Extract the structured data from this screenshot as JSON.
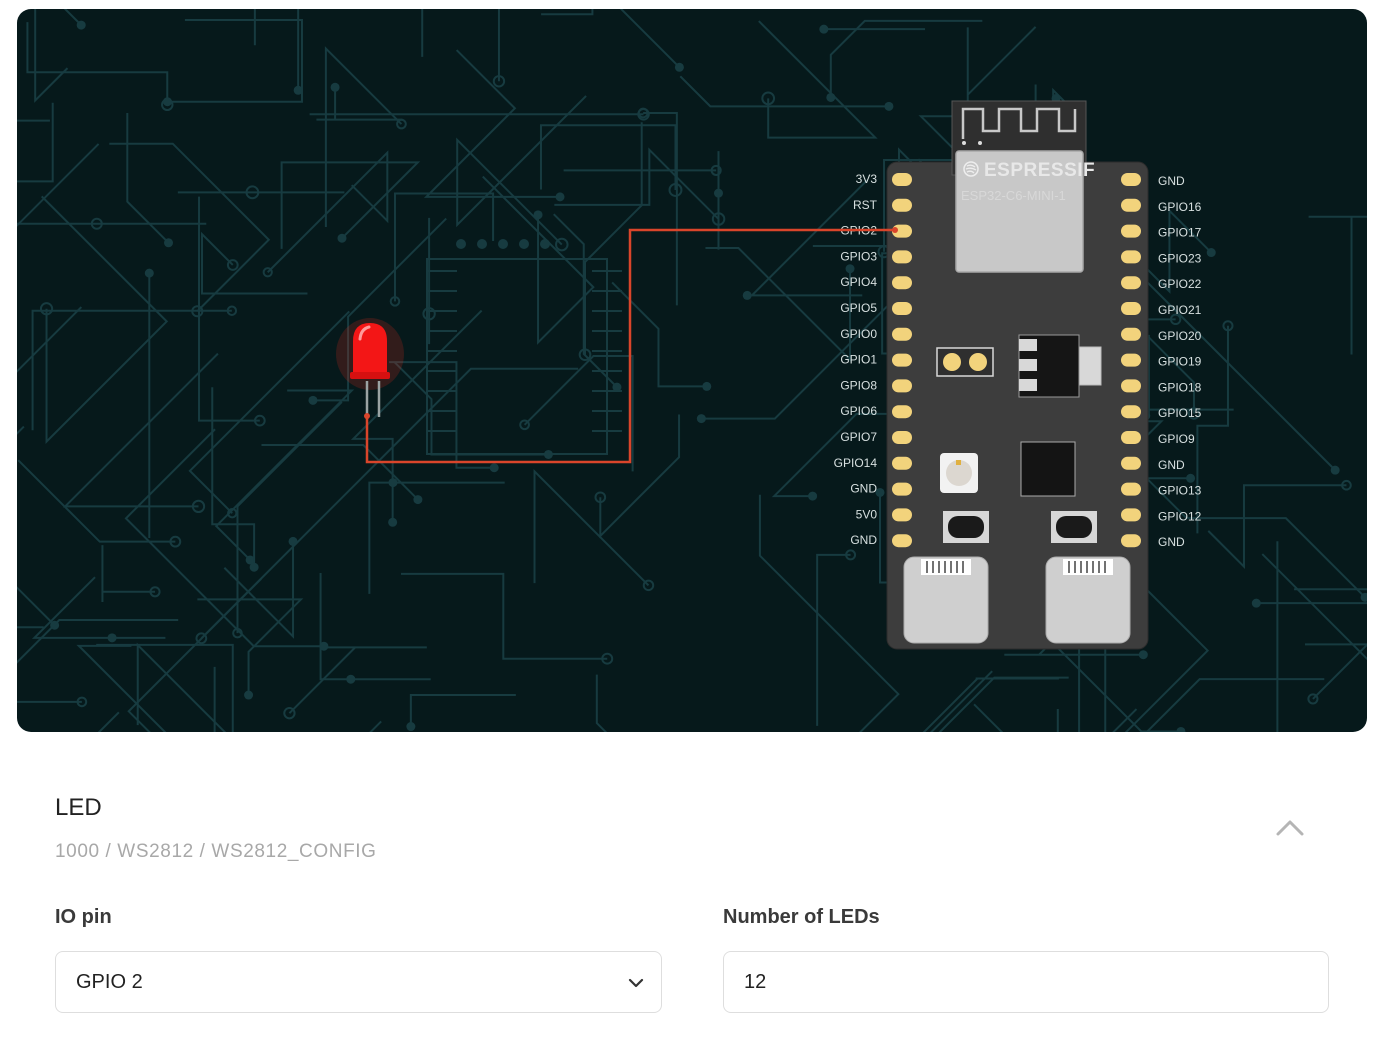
{
  "board": {
    "brand": "ESPRESSIF",
    "module": "ESP32-C6-MINI-1",
    "left_pins": [
      "3V3",
      "RST",
      "GPIO2",
      "GPIO3",
      "GPIO4",
      "GPIO5",
      "GPIO0",
      "GPIO1",
      "GPIO8",
      "GPIO6",
      "GPIO7",
      "GPIO14",
      "GND",
      "5V0",
      "GND"
    ],
    "right_pins": [
      "GND",
      "GPIO16",
      "GPIO17",
      "GPIO23",
      "GPIO22",
      "GPIO21",
      "GPIO20",
      "GPIO19",
      "GPIO18",
      "GPIO15",
      "GPIO9",
      "GND",
      "GPIO13",
      "GPIO12",
      "GND"
    ],
    "connected_pin": "GPIO2"
  },
  "colors": {
    "background": "#06191b",
    "trace": "#173b40",
    "wire": "#d9452b",
    "led": "#ff1a1a",
    "board": "#3d3d3d",
    "pad": "#f2d37c"
  },
  "component": {
    "title": "LED",
    "path": "1000 / WS2812 / WS2812_CONFIG",
    "collapse_icon": "chevron-up-icon"
  },
  "fields": {
    "io_pin": {
      "label": "IO pin",
      "value": "GPIO 2"
    },
    "num_leds": {
      "label": "Number of LEDs",
      "value": "12"
    }
  }
}
